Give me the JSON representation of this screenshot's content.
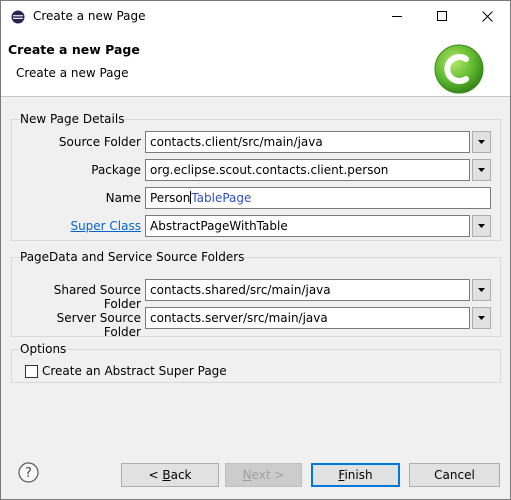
{
  "window": {
    "title": "Create a new Page"
  },
  "banner": {
    "title": "Create a new Page",
    "subtitle": "Create a new Page"
  },
  "group_details": {
    "title": "New Page Details",
    "source_folder": {
      "label": "Source Folder",
      "value": "contacts.client/src/main/java"
    },
    "package": {
      "label": "Package",
      "value": "org.eclipse.scout.contacts.client.person"
    },
    "name": {
      "label": "Name",
      "value_typed": "Person",
      "value_suggestion": "TablePage"
    },
    "super_class": {
      "label": "Super Class",
      "value": "AbstractPageWithTable"
    }
  },
  "group_pagedata": {
    "title": "PageData and Service Source Folders",
    "shared_source_folder": {
      "label": "Shared Source Folder",
      "value": "contacts.shared/src/main/java"
    },
    "server_source_folder": {
      "label": "Server Source Folder",
      "value": "contacts.server/src/main/java"
    }
  },
  "group_options": {
    "title": "Options",
    "abstract_super_page": {
      "label": "Create an Abstract Super Page",
      "checked": false
    }
  },
  "buttons": {
    "back_prefix": "< ",
    "back_mnemonic": "B",
    "back_rest": "ack",
    "next_mnemonic": "N",
    "next_rest": "ext >",
    "finish_mnemonic": "F",
    "finish_rest": "inish",
    "cancel": "Cancel"
  },
  "colors": {
    "link": "#0066cc",
    "default_button_border": "#0078d7",
    "logo_green": "#5cb82e"
  }
}
